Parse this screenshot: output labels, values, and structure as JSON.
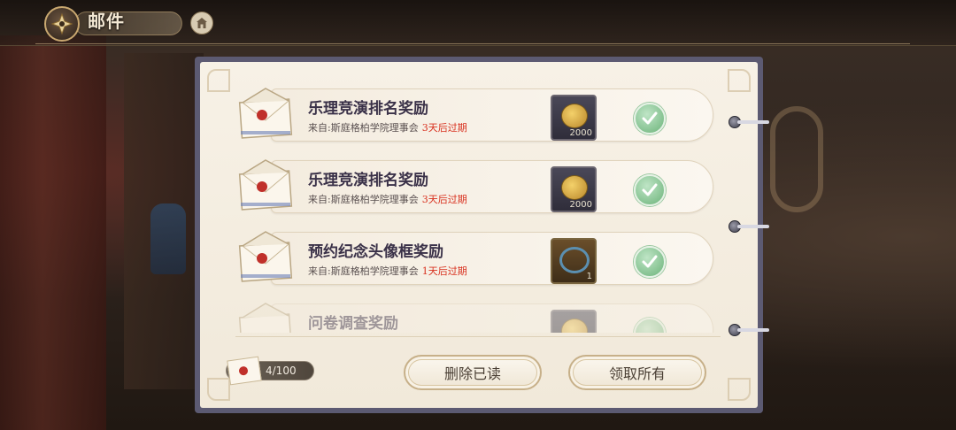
{
  "header": {
    "title": "邮件",
    "logo_icon": "compass-emblem-icon",
    "home_icon": "home-icon"
  },
  "mails": [
    {
      "title": "乐理竞演排名奖励",
      "from": "来自:斯庭格柏学院理事会",
      "expiry": "3天后过期",
      "reward_icon": "gold-coin-icon",
      "reward_count": "2000"
    },
    {
      "title": "乐理竞演排名奖励",
      "from": "来自:斯庭格柏学院理事会",
      "expiry": "3天后过期",
      "reward_icon": "gold-coin-icon",
      "reward_count": "2000"
    },
    {
      "title": "预约纪念头像框奖励",
      "from": "来自:斯庭格柏学院理事会",
      "expiry": "1天后过期",
      "reward_icon": "avatar-frame-icon",
      "reward_count": "1"
    },
    {
      "title": "问卷调查奖励",
      "from": "",
      "expiry": "",
      "reward_icon": "gold-coin-icon",
      "reward_count": ""
    }
  ],
  "footer": {
    "mail_count": "4/100",
    "delete_read_label": "删除已读",
    "claim_all_label": "领取所有"
  },
  "colors": {
    "expiry": "#d8301e",
    "panel_border": "#5c5a72",
    "check_green": "#6cb37a"
  }
}
